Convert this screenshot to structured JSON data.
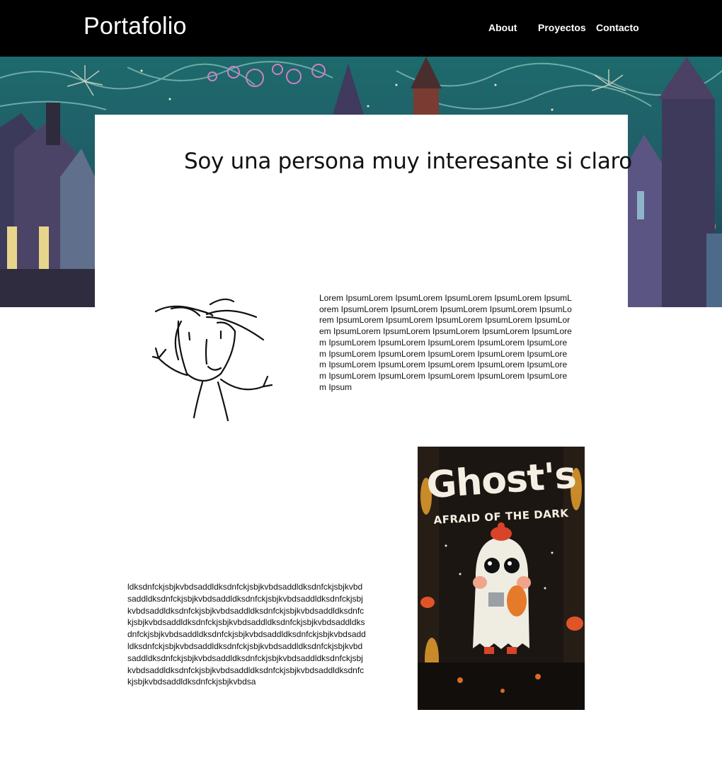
{
  "header": {
    "logo": "Portafolio",
    "nav": [
      "About",
      "Proyectos",
      "Contacto"
    ]
  },
  "hero": {
    "image": "night-castle-illustration"
  },
  "intro": {
    "headline": "Soy una persona muy interesante si claro"
  },
  "about": {
    "doodle": "stick-figure-self-portrait",
    "text": "Lorem IpsumLorem IpsumLorem IpsumLorem IpsumLorem IpsumLorem IpsumLorem IpsumLorem IpsumLorem IpsumLorem IpsumLorem IpsumLorem IpsumLorem IpsumLorem IpsumLorem IpsumLorem IpsumLorem IpsumLorem IpsumLorem IpsumLorem IpsumLorem IpsumLorem IpsumLorem IpsumLorem IpsumLorem IpsumLorem IpsumLorem IpsumLorem IpsumLorem IpsumLorem IpsumLorem IpsumLorem IpsumLorem IpsumLorem IpsumLorem IpsumLorem IpsumLorem IpsumLorem IpsumLorem IpsumLorem IpsumLorem Ipsum"
  },
  "project": {
    "text": "ldksdnfckjsbjkvbdsaddldksdnfckjsbjkvbdsaddldksdnfckjsbjkvbdsaddldksdnfckjsbjkvbdsaddldksdnfckjsbjkvbdsaddldksdnfckjsbjkvbdsaddldksdnfckjsbjkvbdsaddldksdnfckjsbjkvbdsaddldksdnfckjsbjkvbdsaddldksdnfckjsbjkvbdsaddldksdnfckjsbjkvbdsaddldksdnfckjsbjkvbdsaddldksdnfckjsbjkvbdsaddldksdnfckjsbjkvbdsaddldksdnfckjsbjkvbdsaddldksdnfckjsbjkvbdsaddldksdnfckjsbjkvbdsaddldksdnfckjsbjkvbdsaddldksdnfckjsbjkvbdsaddldksdnfckjsbjkvbdsaddldksdnfckjsbjkvbdsaddldksdnfckjsbjkvbdsaddldksdnfckjsbjkvbdsaddldksdnfckjsbjkvbdsa",
    "book": {
      "title": "Ghost's",
      "subtitle": "AFRAID OF THE DARK"
    }
  },
  "colors": {
    "header_bg": "#000000",
    "hero_sky": "#1f5a5e",
    "book_bg": "#1c1612",
    "book_accent": "#e0542a"
  }
}
